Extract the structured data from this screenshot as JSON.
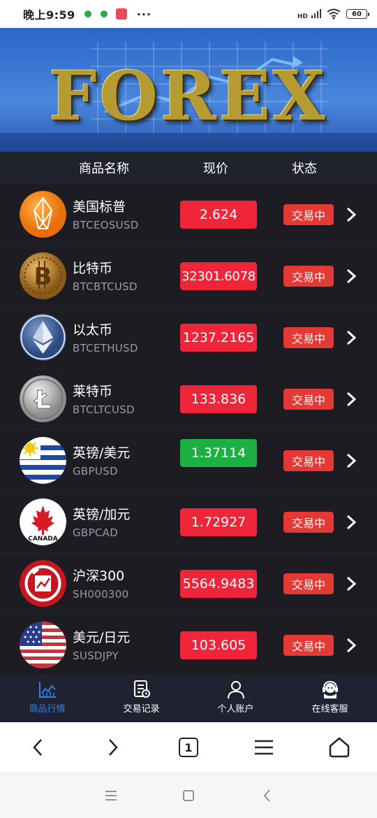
{
  "status_bar": {
    "time": "晚上9:59",
    "more": "···",
    "hd": "HD",
    "battery": "60"
  },
  "banner": {
    "text": "FOREX"
  },
  "table_header": {
    "name": "商品名称",
    "price": "现价",
    "status": "状态"
  },
  "items": [
    {
      "name": "美国标普",
      "code": "BTCEOSUSD",
      "price": "2.624",
      "trend": "down",
      "status": "交易中",
      "icon": "eos-icon"
    },
    {
      "name": "比特币",
      "code": "BTCBTCUSD",
      "price": "32301.6078",
      "trend": "down",
      "status": "交易中",
      "icon": "bitcoin-icon"
    },
    {
      "name": "以太币",
      "code": "BTCETHUSD",
      "price": "1237.2165",
      "trend": "down",
      "status": "交易中",
      "icon": "ethereum-icon"
    },
    {
      "name": "莱特币",
      "code": "BTCLTCUSD",
      "price": "133.836",
      "trend": "down",
      "status": "交易中",
      "icon": "litecoin-icon"
    },
    {
      "name": "英镑/美元",
      "code": "GBPUSD",
      "price": "1.37114",
      "trend": "up",
      "status": "交易中",
      "icon": "uruguay-flag-icon"
    },
    {
      "name": "英镑/加元",
      "code": "GBPCAD",
      "price": "1.72927",
      "trend": "down",
      "status": "交易中",
      "icon": "canada-flag-icon"
    },
    {
      "name": "沪深300",
      "code": "SH000300",
      "price": "5564.9483",
      "trend": "down",
      "status": "交易中",
      "icon": "index-chart-icon"
    },
    {
      "name": "美元/日元",
      "code": "SUSDJPY",
      "price": "103.605",
      "trend": "down",
      "status": "交易中",
      "icon": "usa-flag-icon"
    }
  ],
  "tabbar": [
    {
      "label": "商品行情",
      "icon": "market-chart-icon",
      "active": true
    },
    {
      "label": "交易记录",
      "icon": "trade-record-icon",
      "active": false
    },
    {
      "label": "个人账户",
      "icon": "user-account-icon",
      "active": false
    },
    {
      "label": "在线客服",
      "icon": "customer-service-icon",
      "active": false
    }
  ],
  "browser": {
    "tab_count": "1"
  },
  "colors": {
    "price_down": "#f0253a",
    "price_up": "#1cb043",
    "status_button": "#e53935",
    "row_bg": "#1c1c22",
    "tab_active": "#2f7ff0"
  }
}
